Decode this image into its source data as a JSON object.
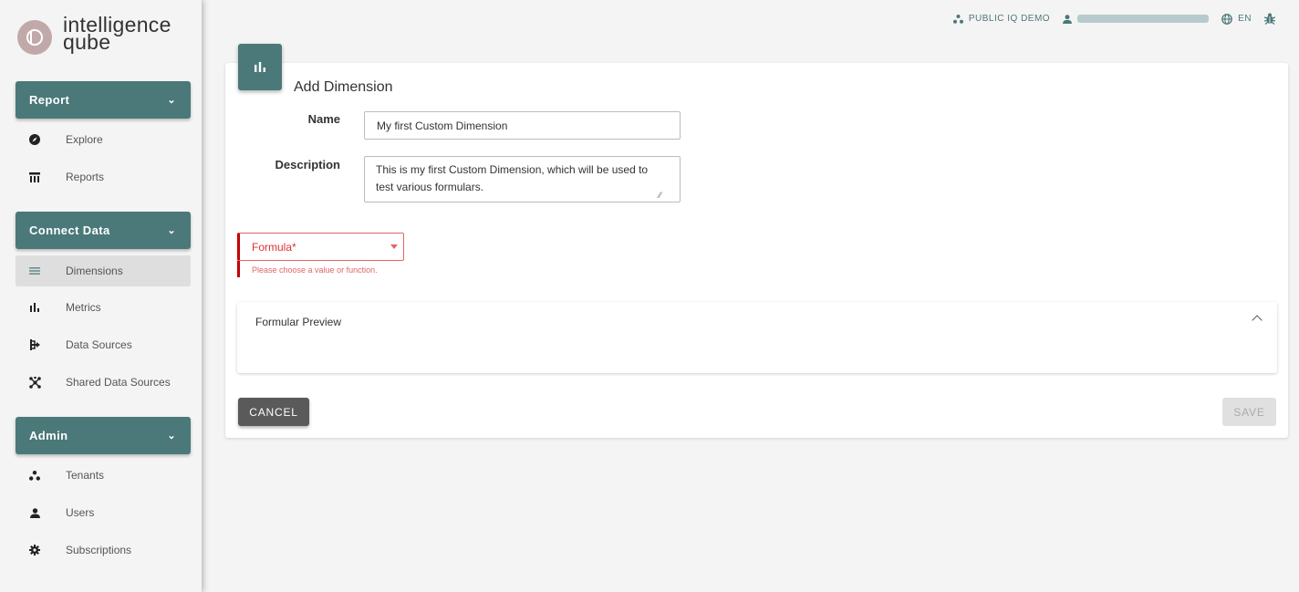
{
  "brand": {
    "line1": "intelligence",
    "line2": "qube"
  },
  "sidebar": {
    "sections": [
      {
        "title": "Report",
        "items": [
          {
            "label": "Explore",
            "icon": "compass-icon"
          },
          {
            "label": "Reports",
            "icon": "table-icon"
          }
        ]
      },
      {
        "title": "Connect Data",
        "items": [
          {
            "label": "Dimensions",
            "icon": "list-icon",
            "active": true
          },
          {
            "label": "Metrics",
            "icon": "bar-chart-icon"
          },
          {
            "label": "Data Sources",
            "icon": "source-icon"
          },
          {
            "label": "Shared Data Sources",
            "icon": "shared-icon"
          }
        ]
      },
      {
        "title": "Admin",
        "items": [
          {
            "label": "Tenants",
            "icon": "tenants-icon"
          },
          {
            "label": "Users",
            "icon": "user-icon"
          },
          {
            "label": "Subscriptions",
            "icon": "gear-icon"
          }
        ]
      }
    ]
  },
  "topbar": {
    "tenant": "PUBLIC IQ DEMO",
    "language": "EN"
  },
  "form": {
    "title": "Add Dimension",
    "name_label": "Name",
    "name_value": "My first Custom Dimension",
    "description_label": "Description",
    "description_value": "This is my first Custom Dimension, which will be used to test various formulars.",
    "formula_placeholder": "Formula*",
    "formula_error": "Please choose a value or function.",
    "preview_title": "Formular Preview",
    "cancel_label": "CANCEL",
    "save_label": "SAVE"
  },
  "colors": {
    "accent": "#4b7879",
    "error": "#e06666",
    "cancel_bg": "#5a5a5a"
  }
}
